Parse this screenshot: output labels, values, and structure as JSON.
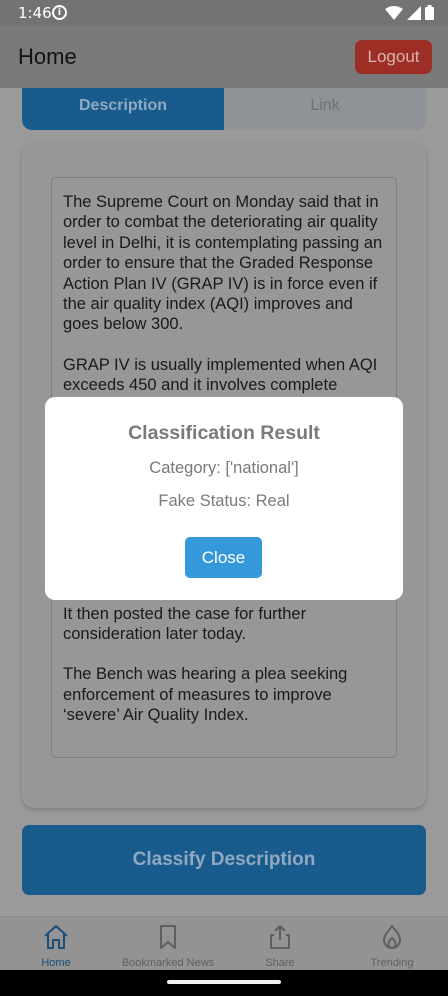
{
  "status_bar": {
    "time": "1:46"
  },
  "header": {
    "title": "Home",
    "logout_label": "Logout"
  },
  "tabs": [
    {
      "label": "Description",
      "active": true
    },
    {
      "label": "Link",
      "active": false
    }
  ],
  "article": {
    "paragraphs": [
      "The Supreme Court on Monday said that in order to combat the deteriorating air quality level in Delhi, it is contemplating passing an order to ensure that the Graded Response Action Plan IV (GRAP IV) is in force even if the air quality index (AQI) improves and goes below 300.",
      "GRAP IV is usually implemented when AQI exceeds 450 and it involves complete",
      "It then posted the case for further consideration later today.",
      "The Bench was hearing a plea seeking enforcement of measures to improve ‘severe’ Air Quality Index."
    ]
  },
  "classify_button": {
    "label": "Classify Description"
  },
  "bottom_nav": {
    "items": [
      {
        "label": "Home",
        "icon": "home-icon",
        "active": true
      },
      {
        "label": "Bookmarked News",
        "icon": "bookmark-icon",
        "active": false
      },
      {
        "label": "Share",
        "icon": "share-icon",
        "active": false
      },
      {
        "label": "Trending",
        "icon": "flame-icon",
        "active": false
      }
    ]
  },
  "modal": {
    "title": "Classification Result",
    "category": "Category: ['national']",
    "fake_status": "Fake Status: Real",
    "close_label": "Close"
  },
  "colors": {
    "primary": "#3598db",
    "logout": "#e53935",
    "overlay": "rgba(0,0,0,0.4)"
  }
}
